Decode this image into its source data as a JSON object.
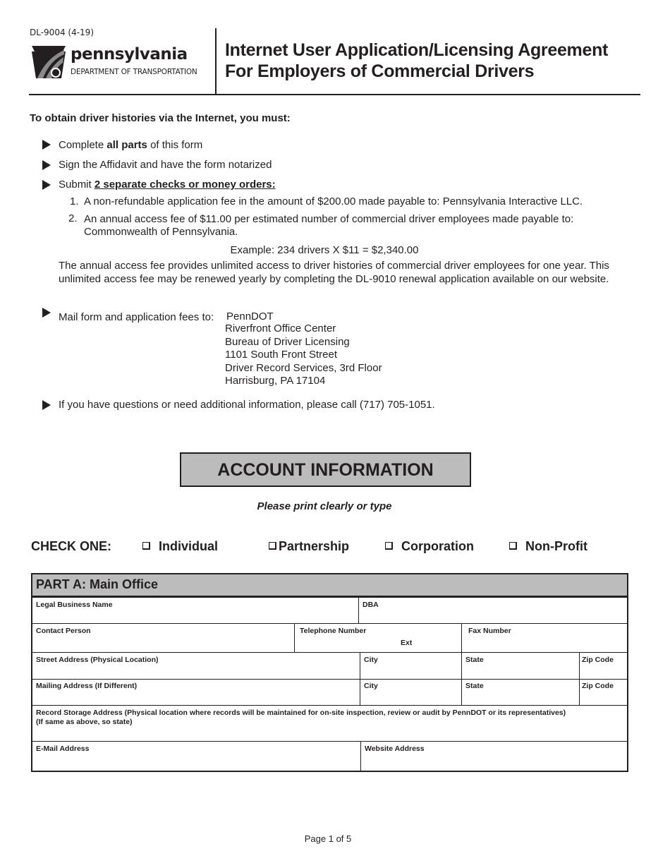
{
  "header": {
    "form_code": "DL-9004 (4-19)",
    "logo_name": "pennsylvania",
    "logo_department": "DEPARTMENT OF TRANSPORTATION",
    "title_line1": "Internet User Application/Licensing Agreement",
    "title_line2": "For Employers of Commercial Drivers"
  },
  "instructions": {
    "intro": "To obtain driver histories via the Internet, you must:",
    "bullet1": {
      "pre": "Complete ",
      "bold": "all parts",
      "post": " of this form"
    },
    "bullet2": "Sign the Affidavit and have the form notarized",
    "bullet3": {
      "pre": "Submit ",
      "bold_underline": "2 separate checks or money orders:"
    },
    "fees": [
      {
        "num": "1.",
        "text": "A non-refundable application fee in the amount of $200.00 made payable to: Pennsylvania Interactive LLC."
      },
      {
        "num": "2.",
        "text": "An annual access fee of $11.00 per estimated number of commercial driver employees made payable to: Commonwealth of Pennsylvania."
      }
    ],
    "example": "Example: 234 drivers X $11 = $2,340.00",
    "annual_note": "The annual access fee provides unlimited access to driver histories of commercial driver employees for one year. This unlimited access fee may be renewed yearly by completing the DL-9010 renewal application available on our website.",
    "mail_label": "Mail form and application fees to:",
    "mail_address": [
      "PennDOT",
      "Riverfront Office Center",
      "Bureau of Driver Licensing",
      "1101 South Front Street",
      "Driver Record Services, 3rd Floor",
      "Harrisburg, PA  17104"
    ],
    "questions": "If you have questions or need additional information, please call (717) 705-1051."
  },
  "account": {
    "heading": "ACCOUNT INFORMATION",
    "print_note": "Please print clearly or type",
    "check_one_label": "CHECK ONE:",
    "options": [
      "Individual",
      "Partnership",
      "Corporation",
      "Non-Profit"
    ]
  },
  "part_a": {
    "heading": "PART A: Main Office",
    "fields": {
      "legal_business_name": "Legal Business Name",
      "dba": "DBA",
      "contact_person": "Contact Person",
      "telephone_number": "Telephone Number",
      "ext": "Ext",
      "fax_number": "Fax Number",
      "street_address": "Street Address (Physical Location)",
      "city": "City",
      "state": "State",
      "zip_code": "Zip Code",
      "mailing_address": "Mailing Address (If Different)",
      "record_storage_line1": "Record Storage Address (Physical location where records will be maintained for on-site inspection, review or audit by PennDOT or its representatives)",
      "record_storage_line2": "(If same as above, so state)",
      "email_address": "E-Mail Address",
      "website_address": "Website Address"
    }
  },
  "footer": {
    "page": "Page 1 of 5"
  }
}
